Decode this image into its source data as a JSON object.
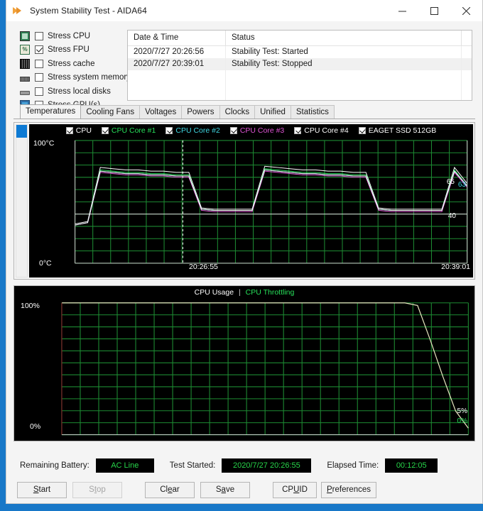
{
  "window": {
    "title": "System Stability Test - AIDA64",
    "icon": "aida64-flame-icon",
    "minimize": "minimize-icon",
    "maximize": "maximize-icon",
    "close": "close-icon"
  },
  "stress_options": [
    {
      "label": "Stress CPU",
      "checked": false,
      "icon": "cpu-chip-icon"
    },
    {
      "label": "Stress FPU",
      "checked": true,
      "icon": "fpu-icon"
    },
    {
      "label": "Stress cache",
      "checked": false,
      "icon": "cache-icon"
    },
    {
      "label": "Stress system memory",
      "checked": false,
      "icon": "memory-stick-icon"
    },
    {
      "label": "Stress local disks",
      "checked": false,
      "icon": "hard-disk-icon"
    },
    {
      "label": "Stress GPU(s)",
      "checked": false,
      "icon": "gpu-monitor-icon"
    }
  ],
  "status_table": {
    "columns": [
      "Date & Time",
      "Status"
    ],
    "rows": [
      {
        "datetime": "2020/7/27 20:26:56",
        "status": "Stability Test: Started"
      },
      {
        "datetime": "2020/7/27 20:39:01",
        "status": "Stability Test: Stopped"
      }
    ]
  },
  "tabs": [
    {
      "label": "Temperatures",
      "active": true
    },
    {
      "label": "Cooling Fans",
      "active": false
    },
    {
      "label": "Voltages",
      "active": false
    },
    {
      "label": "Powers",
      "active": false
    },
    {
      "label": "Clocks",
      "active": false
    },
    {
      "label": "Unified",
      "active": false
    },
    {
      "label": "Statistics",
      "active": false
    }
  ],
  "temperature_chart": {
    "legend": [
      {
        "label": "CPU",
        "color": "#ffffff",
        "checked": true
      },
      {
        "label": "CPU Core #1",
        "color": "#27e05a",
        "checked": true
      },
      {
        "label": "CPU Core #2",
        "color": "#3fd6e0",
        "checked": true
      },
      {
        "label": "CPU Core #3",
        "color": "#e055d6",
        "checked": true
      },
      {
        "label": "CPU Core #4",
        "color": "#ffffff",
        "checked": true
      },
      {
        "label": "EAGET SSD 512GB",
        "color": "#ffffff",
        "checked": true
      }
    ],
    "y_top": "100°C",
    "y_bottom": "0°C",
    "x_left": "20:26:55",
    "x_right": "20:39:01",
    "right_labels": [
      {
        "text": "65",
        "color": "#ffffff"
      },
      {
        "text": "63",
        "color": "#3fd6e0"
      },
      {
        "text": "40",
        "color": "#ffffff"
      }
    ]
  },
  "usage_chart": {
    "title_primary": "CPU Usage",
    "title_separator": "|",
    "title_secondary": "CPU Throttling",
    "title_primary_color": "#ffffff",
    "title_secondary_color": "#27e05a",
    "y_top": "100%",
    "y_bottom": "0%",
    "right_labels": [
      {
        "text": "5%",
        "color": "#ffffff"
      },
      {
        "text": "0%",
        "color": "#27e05a"
      }
    ]
  },
  "status_strip": {
    "battery_label": "Remaining Battery:",
    "battery_value": "AC Line",
    "started_label": "Test Started:",
    "started_value": "2020/7/27 20:26:55",
    "elapsed_label": "Elapsed Time:",
    "elapsed_value": "00:12:05",
    "value_color": "#27d64a"
  },
  "buttons": [
    {
      "label": "Start",
      "accel": "S",
      "disabled": false,
      "width": 70
    },
    {
      "label": "Stop",
      "accel": "t",
      "disabled": true,
      "width": 70
    },
    {
      "label": "Clear",
      "accel": "e",
      "disabled": false,
      "width": 70
    },
    {
      "label": "Save",
      "accel": "a",
      "disabled": false,
      "width": 70
    },
    {
      "label": "CPUID",
      "accel": "U",
      "disabled": false,
      "width": 62
    },
    {
      "label": "Preferences",
      "accel": "P",
      "disabled": false,
      "width": 78
    }
  ],
  "chart_data": [
    {
      "type": "line",
      "title": "Temperatures",
      "xlabel": "",
      "ylabel": "°C",
      "ylim": [
        0,
        100
      ],
      "x": [
        "20:26:55",
        "20:39:01"
      ],
      "grid": true,
      "legend_position": "top",
      "series": [
        {
          "name": "CPU",
          "color": "#ffffff",
          "values": [
            32,
            34,
            78,
            77,
            76,
            76,
            75,
            75,
            74,
            74,
            45,
            44,
            44,
            44,
            44,
            79,
            78,
            77,
            76,
            76,
            75,
            75,
            74,
            74,
            45,
            44,
            44,
            44,
            44,
            44,
            78,
            65
          ]
        },
        {
          "name": "CPU Core #1",
          "color": "#27e05a",
          "values": [
            31,
            33,
            76,
            75,
            74,
            74,
            73,
            73,
            72,
            72,
            44,
            43,
            43,
            43,
            43,
            77,
            76,
            75,
            74,
            74,
            73,
            73,
            72,
            72,
            44,
            43,
            43,
            43,
            43,
            43,
            76,
            63
          ]
        },
        {
          "name": "CPU Core #2",
          "color": "#3fd6e0",
          "values": [
            31,
            33,
            75,
            74,
            73,
            73,
            72,
            72,
            71,
            71,
            44,
            43,
            43,
            43,
            43,
            76,
            75,
            74,
            73,
            73,
            72,
            72,
            71,
            71,
            44,
            43,
            43,
            43,
            43,
            43,
            75,
            63
          ]
        },
        {
          "name": "CPU Core #3",
          "color": "#e055d6",
          "values": [
            31,
            33,
            74,
            73,
            72,
            72,
            71,
            71,
            70,
            70,
            43,
            42,
            42,
            42,
            42,
            75,
            74,
            73,
            72,
            72,
            71,
            71,
            70,
            70,
            43,
            42,
            42,
            42,
            42,
            42,
            74,
            62
          ]
        },
        {
          "name": "CPU Core #4",
          "color": "#ffffff",
          "values": [
            31,
            33,
            75,
            74,
            73,
            73,
            72,
            72,
            71,
            71,
            44,
            43,
            43,
            43,
            43,
            76,
            75,
            74,
            73,
            73,
            72,
            72,
            71,
            71,
            44,
            43,
            43,
            43,
            43,
            43,
            75,
            63
          ]
        },
        {
          "name": "EAGET SSD 512GB",
          "color": "#d0d0d0",
          "values": [
            40,
            40,
            40,
            40,
            40,
            40,
            40,
            40,
            40,
            40,
            40,
            40,
            40,
            40,
            40,
            40,
            40,
            40,
            40,
            40,
            40,
            40,
            40,
            40,
            40,
            40,
            40,
            40,
            40,
            40,
            40,
            40
          ]
        }
      ],
      "markers": [
        {
          "type": "vline",
          "x_fraction": 0.275,
          "style": "dashed",
          "color": "#ffffff"
        },
        {
          "type": "hline",
          "y": 40,
          "style": "solid",
          "color": "#d8d8d8"
        }
      ]
    },
    {
      "type": "line",
      "title": "CPU Usage | CPU Throttling",
      "xlabel": "",
      "ylabel": "%",
      "ylim": [
        0,
        100
      ],
      "grid": true,
      "legend_position": "top",
      "series": [
        {
          "name": "CPU Usage",
          "color": "#e8e8c0",
          "values": [
            100,
            100,
            100,
            100,
            100,
            100,
            100,
            100,
            100,
            100,
            100,
            100,
            100,
            100,
            100,
            100,
            100,
            100,
            100,
            100,
            100,
            100,
            100,
            100,
            100,
            100,
            100,
            100,
            98,
            72,
            44,
            18,
            5
          ]
        },
        {
          "name": "CPU Throttling",
          "color": "#27e05a",
          "values": [
            0,
            0,
            0,
            0,
            0,
            0,
            0,
            0,
            0,
            0,
            0,
            0,
            0,
            0,
            0,
            0,
            0,
            0,
            0,
            0,
            0,
            0,
            0,
            0,
            0,
            0,
            0,
            0,
            0,
            0,
            0,
            0,
            0
          ]
        }
      ]
    }
  ]
}
